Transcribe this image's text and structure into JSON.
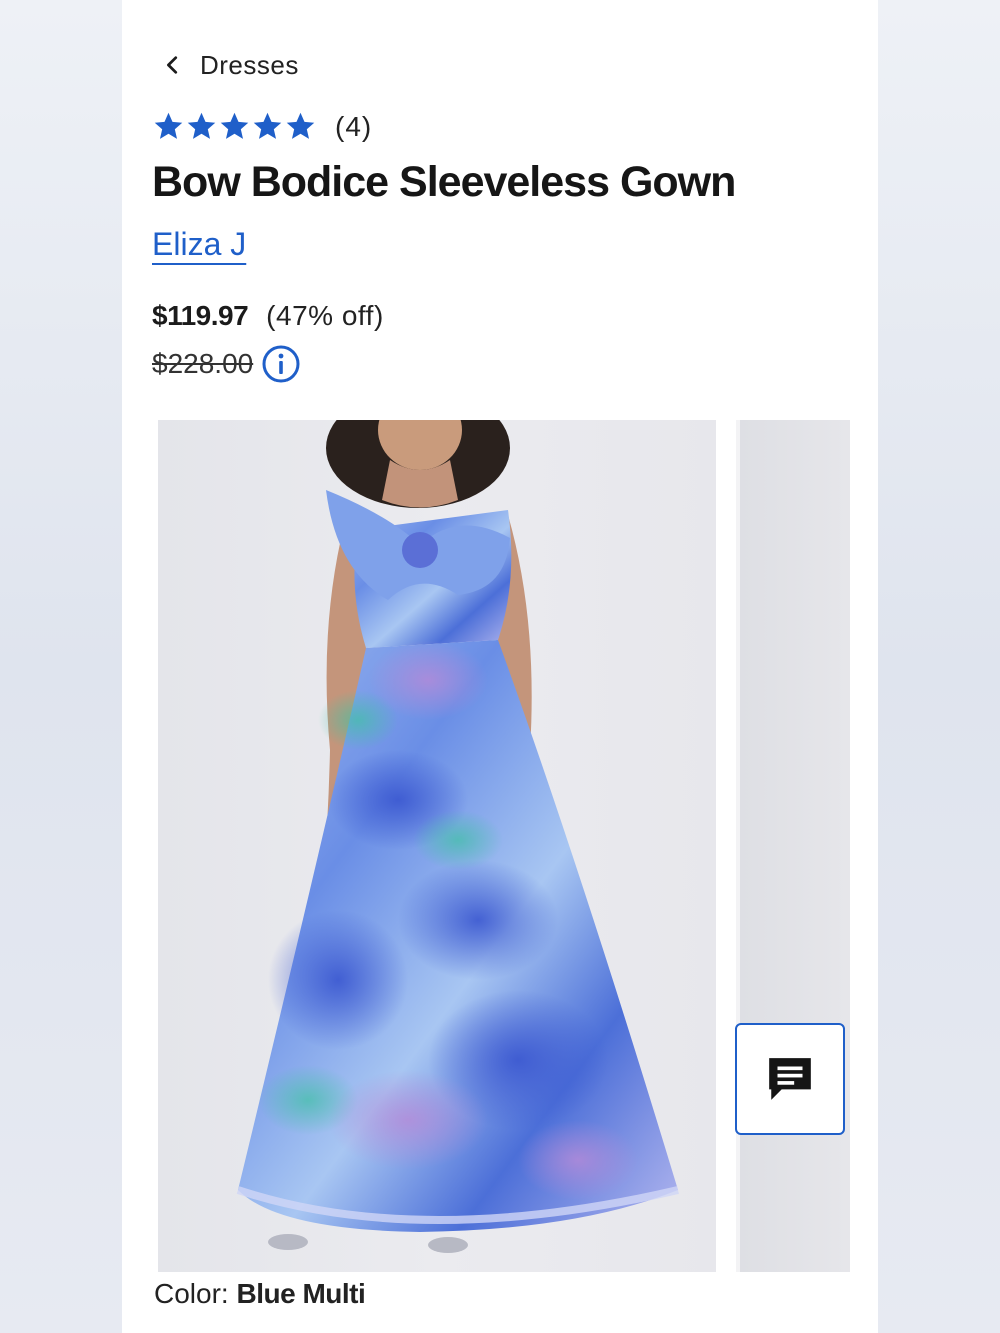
{
  "breadcrumb": {
    "label": "Dresses"
  },
  "rating": {
    "stars": 5,
    "count_label": "(4)",
    "star_color": "#1f5fc9"
  },
  "product": {
    "title": "Bow Bodice Sleeveless Gown",
    "brand": "Eliza J",
    "sale_price": "$119.97",
    "discount": "(47% off)",
    "original_price": "$228.00"
  },
  "color": {
    "label": "Color:",
    "value": "Blue Multi"
  },
  "colors": {
    "accent": "#1f5fc9",
    "text": "#1b1b1b"
  },
  "icons": {
    "back": "chevron-left-icon",
    "info": "info-icon",
    "chat": "chat-icon"
  }
}
